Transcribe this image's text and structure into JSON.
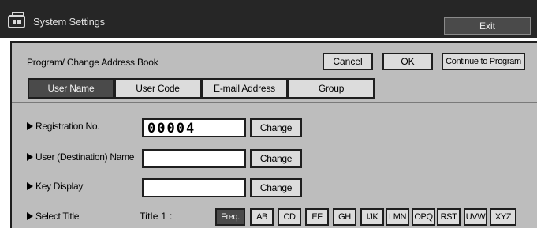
{
  "window": {
    "title": "System Settings",
    "exit_label": "Exit"
  },
  "panel": {
    "title": "Program/ Change Address Book",
    "cancel_label": "Cancel",
    "ok_label": "OK",
    "continue_label": "Continue to Program"
  },
  "tabs": [
    {
      "label": "User Name",
      "selected": true
    },
    {
      "label": "User Code",
      "selected": false
    },
    {
      "label": "E-mail Address",
      "selected": false
    },
    {
      "label": "Group",
      "selected": false
    }
  ],
  "fields": {
    "registration": {
      "label": "Registration No.",
      "value": "00004",
      "button": "Change"
    },
    "user_name": {
      "label": "User (Destination) Name",
      "value": "",
      "button": "Change"
    },
    "key_display": {
      "label": "Key Display",
      "value": "",
      "button": "Change"
    }
  },
  "select_title": {
    "label": "Select Title",
    "title_number": "Title  1 :",
    "keys": [
      "Freq.",
      "AB",
      "CD",
      "EF",
      "GH",
      "IJK",
      "LMN",
      "OPQ",
      "RST",
      "UVW",
      "XYZ"
    ],
    "selected": "Freq."
  },
  "colors": {
    "title_bar": "#262626",
    "panel": "#bdbdbd",
    "selected_button": "#4a4a4a",
    "button": "#dcdcdc"
  }
}
